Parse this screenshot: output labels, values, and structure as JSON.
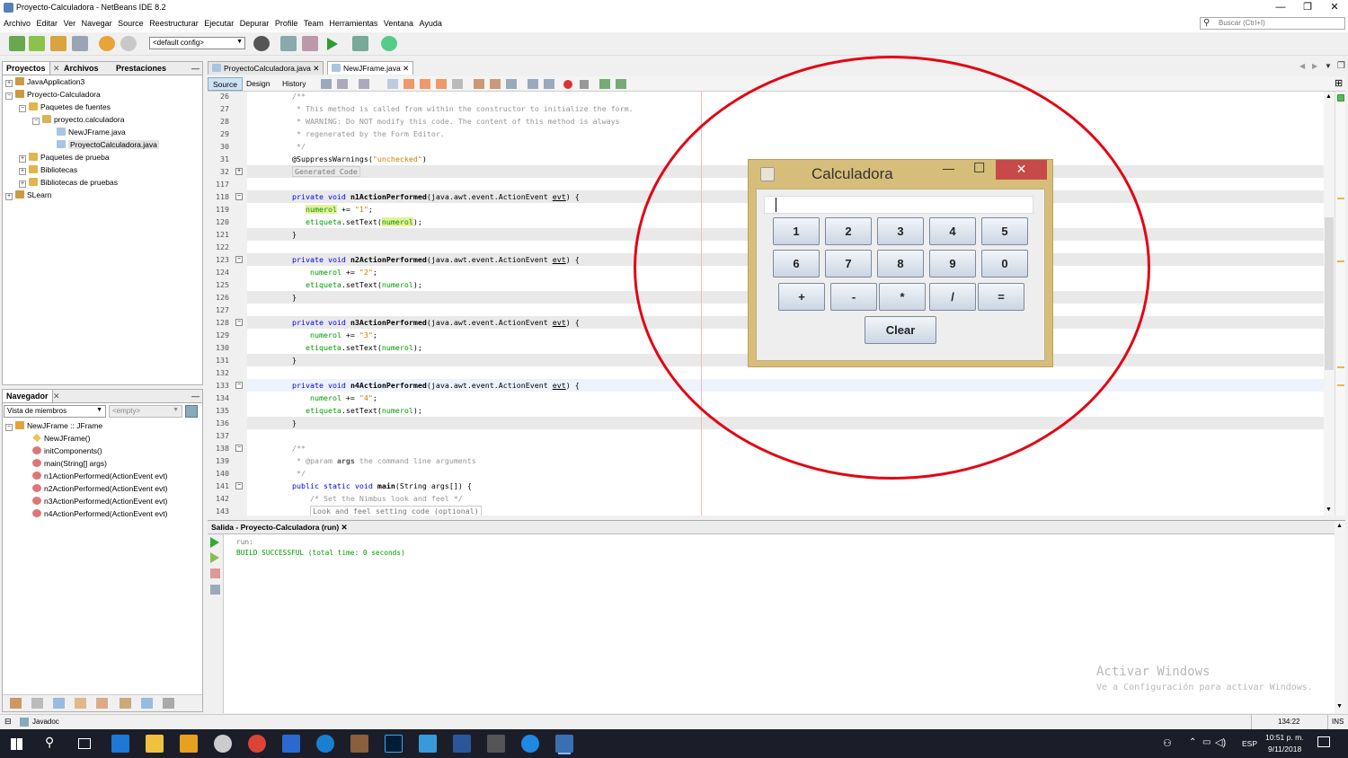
{
  "window": {
    "title": "Proyecto-Calculadora - NetBeans IDE 8.2",
    "min": "—",
    "max": "❐",
    "close": "✕"
  },
  "menu": [
    "Archivo",
    "Editar",
    "Ver",
    "Navegar",
    "Source",
    "Reestructurar",
    "Ejecutar",
    "Depurar",
    "Profile",
    "Team",
    "Herramientas",
    "Ventana",
    "Ayuda"
  ],
  "search": {
    "placeholder": "Buscar (Ctrl+I)"
  },
  "toolbar": {
    "config": "<default config>"
  },
  "projects_panel": {
    "tabs": [
      "Proyectos",
      "Archivos",
      "Prestaciones"
    ],
    "items": [
      "JavaApplication3",
      "Proyecto-Calculadora",
      "Paquetes de fuentes",
      "proyecto.calculadora",
      "NewJFrame.java",
      "ProyectoCalculadora.java",
      "Paquetes de prueba",
      "Bibliotecas",
      "Bibliotecas de pruebas",
      "SLearn"
    ]
  },
  "navigator": {
    "title": "Navegador",
    "view": "Vista de miembros",
    "filter": "<empty>",
    "items": [
      "NewJFrame :: JFrame",
      "NewJFrame()",
      "initComponents()",
      "main(String[] args)",
      "n1ActionPerformed(ActionEvent evt)",
      "n2ActionPerformed(ActionEvent evt)",
      "n3ActionPerformed(ActionEvent evt)",
      "n4ActionPerformed(ActionEvent evt)"
    ]
  },
  "editor": {
    "tabs": [
      "ProyectoCalculadora.java",
      "NewJFrame.java"
    ],
    "views": [
      "Source",
      "Design",
      "History"
    ],
    "line_numbers": [
      "26",
      "27",
      "28",
      "29",
      "30",
      "31",
      "32",
      "117",
      "118",
      "119",
      "120",
      "121",
      "122",
      "123",
      "124",
      "125",
      "126",
      "127",
      "128",
      "129",
      "130",
      "131",
      "132",
      "133",
      "134",
      "135",
      "136",
      "137",
      "138",
      "139",
      "140",
      "141",
      "142",
      "143"
    ]
  },
  "calculator": {
    "title": "Calculadora",
    "min": "—",
    "max": "☐",
    "close": "✕",
    "row1": [
      "1",
      "2",
      "3",
      "4",
      "5"
    ],
    "row2": [
      "6",
      "7",
      "8",
      "9",
      "0"
    ],
    "row3": [
      "+",
      "-",
      "*",
      "/",
      "="
    ],
    "clear": "Clear"
  },
  "output": {
    "tab": "Salida - Proyecto-Calculadora (run)",
    "lines": [
      "run:",
      "BUILD SUCCESSFUL (total time: 0 seconds)"
    ]
  },
  "watermark": {
    "title": "Activar Windows",
    "subtitle": "Ve a Configuración para activar Windows."
  },
  "status": {
    "javadoc": "Javadoc",
    "position": "134:22",
    "mode": "INS"
  },
  "taskbar": {
    "lang": "ESP",
    "time": "10:51 p. m.",
    "date": "9/11/2018"
  },
  "colors": {
    "accent_close": "#c74a48",
    "circle": "#e30613",
    "calc_frame": "#d6be7a"
  }
}
